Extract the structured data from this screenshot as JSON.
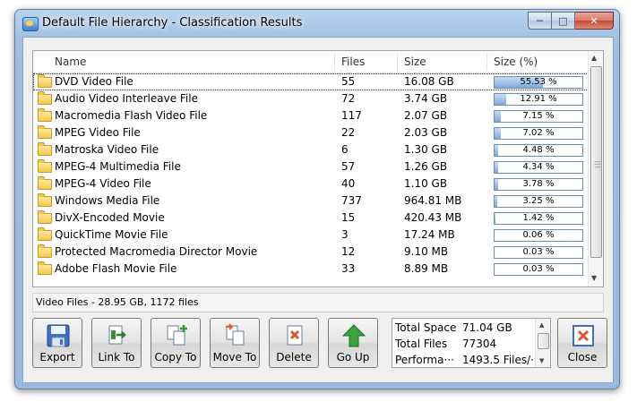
{
  "window": {
    "title": "Default File Hierarchy - Classification Results"
  },
  "columns": {
    "name": "Name",
    "files": "Files",
    "size": "Size",
    "size_pct": "Size (%)"
  },
  "rows": [
    {
      "name": "DVD Video File",
      "files": "55",
      "size": "16.08 GB",
      "pct": 55.53,
      "pct_label": "55.53 %",
      "selected": true
    },
    {
      "name": "Audio Video Interleave File",
      "files": "72",
      "size": "3.74 GB",
      "pct": 12.91,
      "pct_label": "12.91 %"
    },
    {
      "name": "Macromedia Flash Video File",
      "files": "117",
      "size": "2.07 GB",
      "pct": 7.15,
      "pct_label": "7.15 %"
    },
    {
      "name": "MPEG Video File",
      "files": "22",
      "size": "2.03 GB",
      "pct": 7.02,
      "pct_label": "7.02 %"
    },
    {
      "name": "Matroska Video File",
      "files": "6",
      "size": "1.30 GB",
      "pct": 4.48,
      "pct_label": "4.48 %"
    },
    {
      "name": "MPEG-4 Multimedia File",
      "files": "57",
      "size": "1.26 GB",
      "pct": 4.34,
      "pct_label": "4.34 %"
    },
    {
      "name": "MPEG-4 Video File",
      "files": "40",
      "size": "1.10 GB",
      "pct": 3.78,
      "pct_label": "3.78 %"
    },
    {
      "name": "Windows Media File",
      "files": "737",
      "size": "964.81 MB",
      "pct": 3.25,
      "pct_label": "3.25 %"
    },
    {
      "name": "DivX-Encoded Movie",
      "files": "15",
      "size": "420.43 MB",
      "pct": 1.42,
      "pct_label": "1.42 %"
    },
    {
      "name": "QuickTime Movie File",
      "files": "3",
      "size": "17.24 MB",
      "pct": 0.06,
      "pct_label": "0.06 %"
    },
    {
      "name": "Protected Macromedia Director Movie",
      "files": "12",
      "size": "9.10 MB",
      "pct": 0.03,
      "pct_label": "0.03 %"
    },
    {
      "name": "Adobe Flash Movie File",
      "files": "33",
      "size": "8.89 MB",
      "pct": 0.03,
      "pct_label": "0.03 %"
    }
  ],
  "status": {
    "text": "Video Files - 28.95 GB, 1172 files"
  },
  "toolbar": {
    "export": "Export",
    "link_to": "Link To",
    "copy_to": "Copy To",
    "move_to": "Move To",
    "delete": "Delete",
    "go_up": "Go Up",
    "close": "Close"
  },
  "summary": [
    {
      "label": "Total Space",
      "value": "71.04 GB"
    },
    {
      "label": "Total Files",
      "value": "77304"
    },
    {
      "label": "Performa···",
      "value": "1493.5 Files/···"
    }
  ],
  "icons": {
    "app": "app-icon",
    "folder": "folder-icon",
    "export": "floppy-disk-icon",
    "link_to": "link-icon",
    "copy_to": "copy-icon",
    "move_to": "move-icon",
    "delete": "delete-icon",
    "go_up": "up-arrow-icon",
    "close": "close-icon"
  },
  "colors": {
    "bar_fill": "#7ea9dc",
    "bar_border": "#6b8fb7",
    "delete_red": "#e0532f",
    "go_up_green": "#3aa43a"
  }
}
